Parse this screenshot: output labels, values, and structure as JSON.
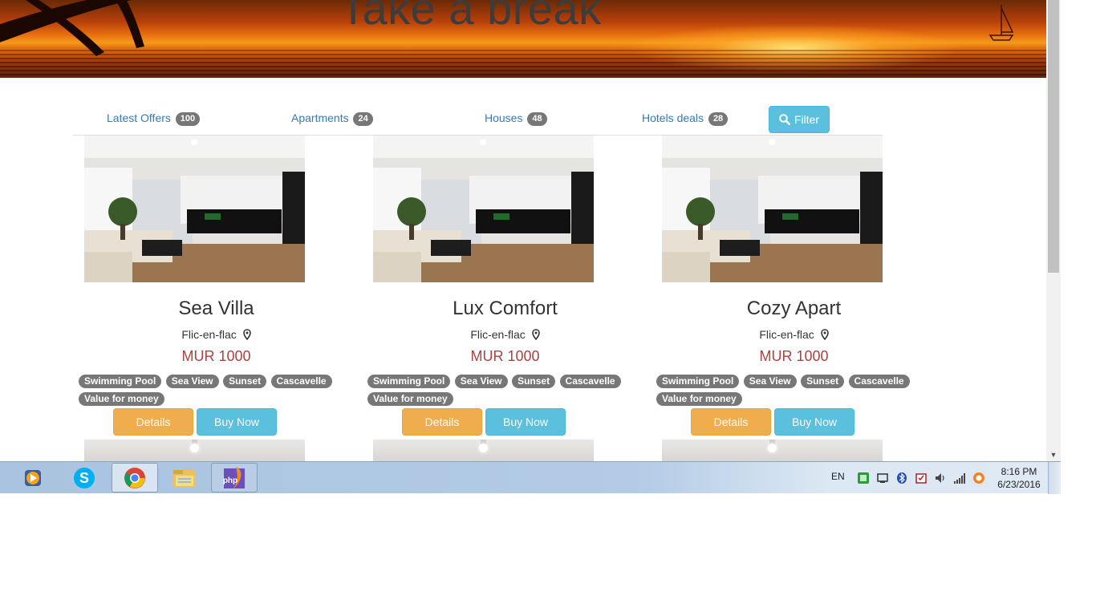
{
  "hero": {
    "title": "Take a break"
  },
  "nav": {
    "tabs": [
      {
        "label": "Latest Offers",
        "count": "100"
      },
      {
        "label": "Apartments",
        "count": "24"
      },
      {
        "label": "Houses",
        "count": "48"
      },
      {
        "label": "Hotels deals",
        "count": "28"
      }
    ],
    "filter_label": "Filter"
  },
  "cards": [
    {
      "title": "Sea Villa",
      "location": "Flic-en-flac",
      "price": "MUR 1000",
      "tags": [
        "Swimming Pool",
        "Sea View",
        "Sunset",
        "Cascavelle",
        "Value for money"
      ],
      "details_label": "Details",
      "buy_label": "Buy Now"
    },
    {
      "title": "Lux Comfort",
      "location": "Flic-en-flac",
      "price": "MUR 1000",
      "tags": [
        "Swimming Pool",
        "Sea View",
        "Sunset",
        "Cascavelle",
        "Value for money"
      ],
      "details_label": "Details",
      "buy_label": "Buy Now"
    },
    {
      "title": "Cozy Apart",
      "location": "Flic-en-flac",
      "price": "MUR 1000",
      "tags": [
        "Swimming Pool",
        "Sea View",
        "Sunset",
        "Cascavelle",
        "Value for money"
      ],
      "details_label": "Details",
      "buy_label": "Buy Now"
    }
  ],
  "taskbar": {
    "apps": [
      "media-player-icon",
      "skype-icon",
      "chrome-icon",
      "file-explorer-icon",
      "phpstorm-icon"
    ],
    "language": "EN",
    "time": "8:16 PM",
    "date": "6/23/2016"
  },
  "colors": {
    "price": "#a94442",
    "badge": "#777777",
    "info": "#5bc0de",
    "warning": "#f0ad4e",
    "link": "#337ab7"
  }
}
